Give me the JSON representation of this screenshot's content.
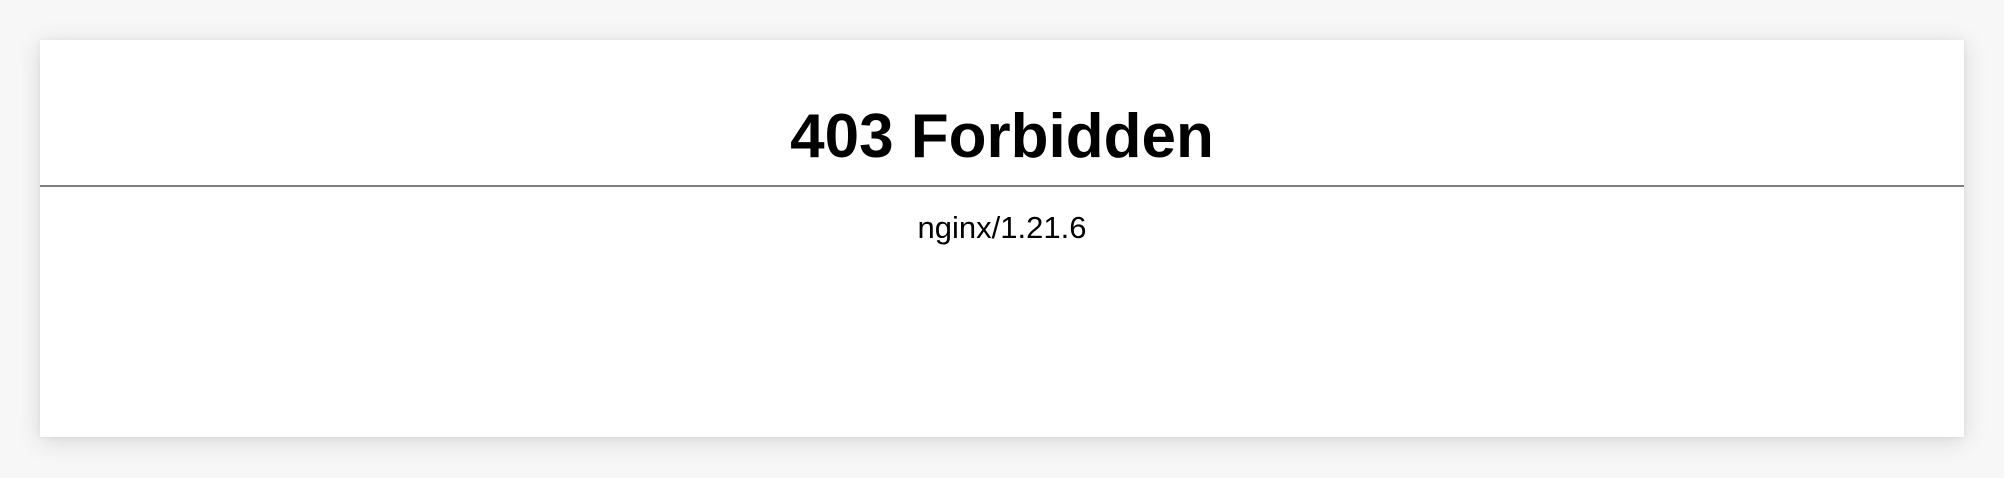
{
  "page": {
    "heading": "403 Forbidden",
    "server_signature": "nginx/1.21.6",
    "colors": {
      "background": "#ffffff",
      "text": "#000000",
      "divider": "#7f7f7f"
    }
  }
}
